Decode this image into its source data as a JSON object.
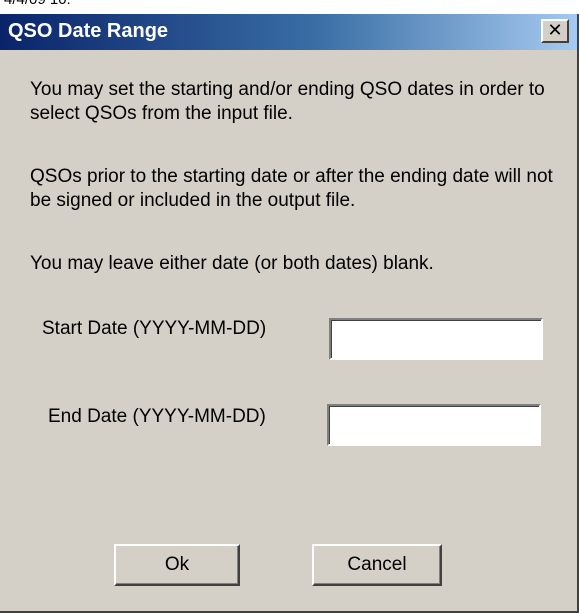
{
  "top_strip": {
    "text": "4/4/09 10:"
  },
  "dialog": {
    "title": "QSO Date Range",
    "close_glyph": "✕",
    "paragraphs": [
      "You may set the starting and/or ending QSO dates in order to select QSOs from the input file.",
      "QSOs prior to the starting date or after the ending date will not be signed or included in the output file.",
      "You may leave either date (or both dates) blank."
    ],
    "start_date": {
      "label": "Start Date (YYYY-MM-DD)",
      "value": ""
    },
    "end_date": {
      "label": "End Date (YYYY-MM-DD)",
      "value": ""
    },
    "buttons": {
      "ok": "Ok",
      "cancel": "Cancel"
    }
  },
  "colors": {
    "title_gradient_start": "#0a246a",
    "title_gradient_end": "#a6caf0",
    "dialog_face": "#d4d0c8"
  },
  "icons": {
    "close": "close-icon"
  }
}
